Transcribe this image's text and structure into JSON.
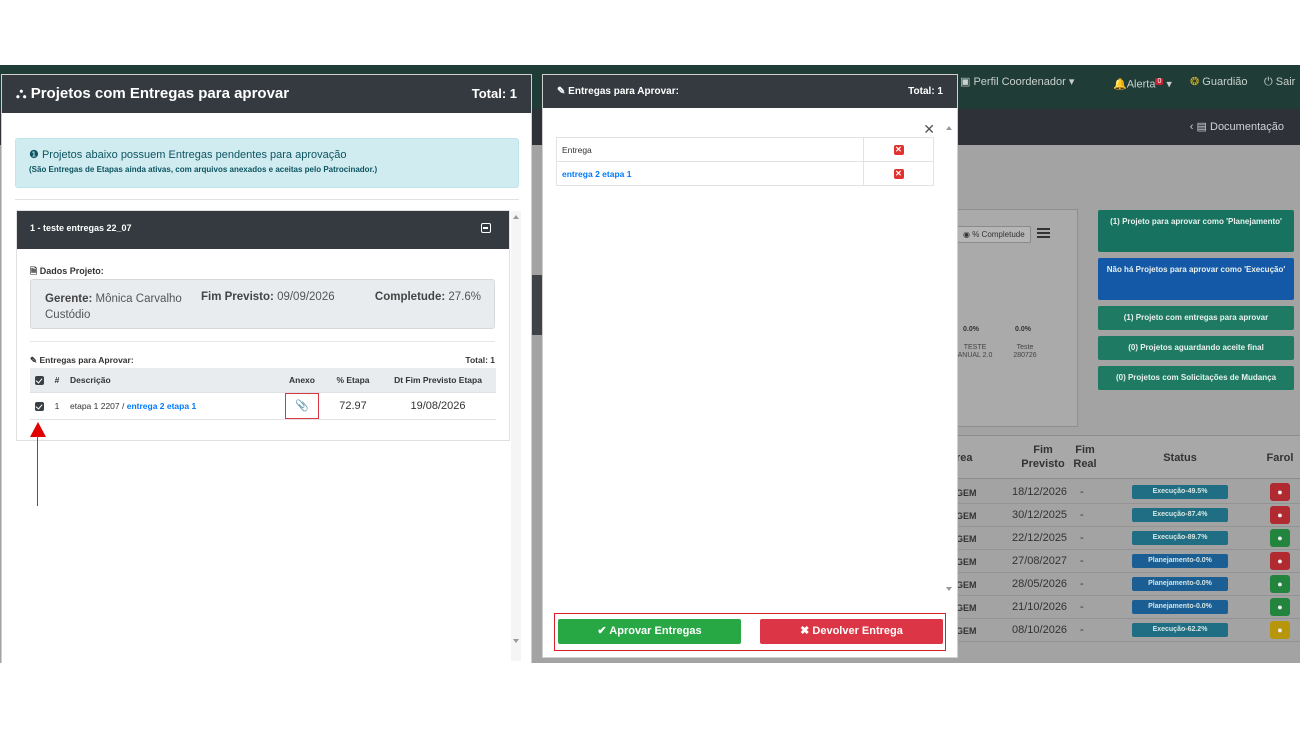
{
  "background": {
    "nav": {
      "perfil": "Perfil Coordenador",
      "alerta": "Alerta",
      "alerta_count": "0",
      "guardiao": "Guardião",
      "sair": "Sair"
    },
    "documentacao": "Documentação",
    "card": {
      "legend": "% Completude",
      "pcts": [
        "0.0%",
        "0.0%"
      ],
      "caps": [
        "TESTE\nANUAL 2.0",
        "Teste\n280726"
      ]
    },
    "side_buttons": [
      {
        "label": "(1) Projeto para aprovar como 'Planejamento'",
        "color": "#17735f"
      },
      {
        "label": "Não há Projetos para aprovar como 'Execução'",
        "color": "#1458a8"
      },
      {
        "label": "(1) Projeto com entregas para aprovar",
        "color": "#1f7a63"
      },
      {
        "label": "(0) Projetos aguardando aceite final",
        "color": "#1f7a63"
      },
      {
        "label": "(0) Projetos com Solicitações de Mudança",
        "color": "#1f7a63"
      }
    ],
    "table": {
      "headers": {
        "area": "rea",
        "fim_previsto": "Fim Previsto",
        "fim_real": "Fim Real",
        "status": "Status",
        "farol": "Farol"
      },
      "rows": [
        {
          "area": "GEM",
          "fim": "18/12/2026",
          "real": "-",
          "status": "Execução-49.5%",
          "status_color": "#1f6e83",
          "farol_color": "#b02a30"
        },
        {
          "area": "GEM",
          "fim": "30/12/2025",
          "real": "-",
          "status": "Execução-87.4%",
          "status_color": "#1f6e83",
          "farol_color": "#b02a30"
        },
        {
          "area": "GEM",
          "fim": "22/12/2025",
          "real": "-",
          "status": "Execução-89.7%",
          "status_color": "#1f6e83",
          "farol_color": "#23843d"
        },
        {
          "area": "GEM",
          "fim": "27/08/2027",
          "real": "-",
          "status": "Planejamento-0.0%",
          "status_color": "#1a5e93",
          "farol_color": "#b02a30"
        },
        {
          "area": "GEM",
          "fim": "28/05/2026",
          "real": "-",
          "status": "Planejamento-0.0%",
          "status_color": "#1a5e93",
          "farol_color": "#23843d"
        },
        {
          "area": "GEM",
          "fim": "21/10/2026",
          "real": "-",
          "status": "Planejamento-0.0%",
          "status_color": "#1a5e93",
          "farol_color": "#23843d"
        },
        {
          "area": "GEM",
          "fim": "08/10/2026",
          "real": "-",
          "status": "Execução-62.2%",
          "status_color": "#1f6e83",
          "farol_color": "#b8960b"
        }
      ]
    }
  },
  "modal_projetos": {
    "title": "Projetos com Entregas para aprovar",
    "total": "Total: 1",
    "info_line1": "Projetos abaixo possuem Entregas pendentes para aprovação",
    "info_line2": "(São Entregas de Etapas ainda ativas, com arquivos anexados e aceitas pelo Patrocinador.)",
    "project": {
      "title": "1 - teste entregas 22_07",
      "dados_label": "Dados Projeto:",
      "gerente_label": "Gerente:",
      "gerente_value": "Mônica Carvalho Custódio",
      "fim_label": "Fim Previsto:",
      "fim_value": "09/09/2026",
      "completude_label": "Completude:",
      "completude_value": "27.6%",
      "entregas_label": "Entregas para Aprovar:",
      "entregas_total": "Total: 1",
      "table_headers": {
        "num": "#",
        "descricao": "Descrição",
        "anexo": "Anexo",
        "pct": "% Etapa",
        "dt": "Dt Fim Previsto Etapa"
      },
      "rows": [
        {
          "num": "1",
          "etapa": "etapa 1 2207 / ",
          "entrega": "entrega 2 etapa 1",
          "pct": "72.97",
          "dt": "19/08/2026"
        }
      ]
    }
  },
  "modal_entregas": {
    "title": "Entregas para Aprovar:",
    "total": "Total: 1",
    "col_entrega": "Entrega",
    "rows": [
      {
        "entrega": "entrega 2 etapa 1"
      }
    ],
    "approve_label": "Aprovar Entregas",
    "return_label": "Devolver Entrega"
  }
}
